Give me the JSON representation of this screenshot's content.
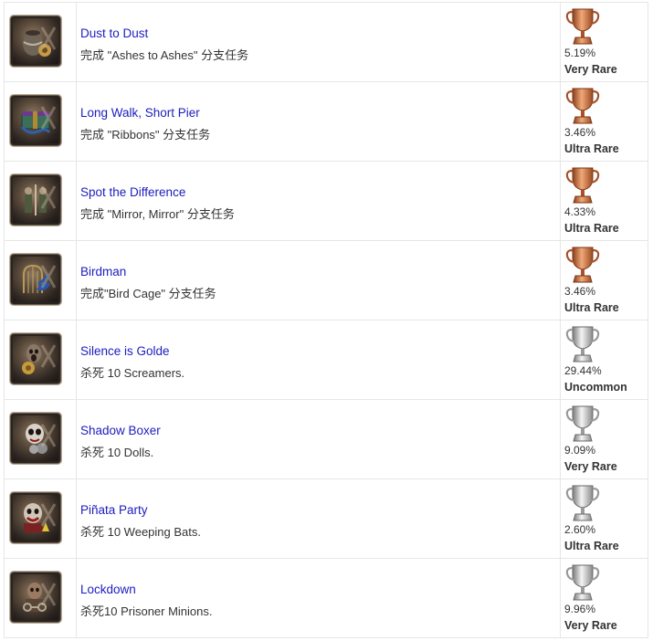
{
  "colors": {
    "bronze": "#c7703f",
    "silver": "#b9b9b9",
    "link": "#1c1cbf",
    "border": "#e6e6e6"
  },
  "achievements": [
    {
      "title": "Dust to Dust",
      "description": "完成 \"Ashes to Ashes\" 分支任务",
      "percent": "5.19%",
      "rarity": "Very Rare",
      "trophy": "bronze",
      "thumb_icon": "urn-icon"
    },
    {
      "title": "Long Walk, Short Pier",
      "description": "完成 \"Ribbons\" 分支任务",
      "percent": "3.46%",
      "rarity": "Ultra Rare",
      "trophy": "bronze",
      "thumb_icon": "gift-box-icon"
    },
    {
      "title": "Spot the Difference",
      "description": "完成 \"Mirror, Mirror\" 分支任务",
      "percent": "4.33%",
      "rarity": "Ultra Rare",
      "trophy": "bronze",
      "thumb_icon": "mirror-figures-icon"
    },
    {
      "title": "Birdman",
      "description": "完成\"Bird Cage\" 分支任务",
      "percent": "3.46%",
      "rarity": "Ultra Rare",
      "trophy": "bronze",
      "thumb_icon": "bird-cage-icon"
    },
    {
      "title": "Silence is Golde",
      "description": "杀死  10 Screamers.",
      "percent": "29.44%",
      "rarity": "Uncommon",
      "trophy": "silver",
      "thumb_icon": "screamer-icon"
    },
    {
      "title": "Shadow Boxer",
      "description": "杀死 10 Dolls.",
      "percent": "9.09%",
      "rarity": "Very Rare",
      "trophy": "silver",
      "thumb_icon": "doll-icon"
    },
    {
      "title": "Piñata Party",
      "description": "杀死 10 Weeping Bats.",
      "percent": "2.60%",
      "rarity": "Ultra Rare",
      "trophy": "silver",
      "thumb_icon": "clown-icon"
    },
    {
      "title": "Lockdown",
      "description": "杀死10 Prisoner Minions.",
      "percent": "9.96%",
      "rarity": "Very Rare",
      "trophy": "silver",
      "thumb_icon": "prisoner-icon"
    }
  ]
}
